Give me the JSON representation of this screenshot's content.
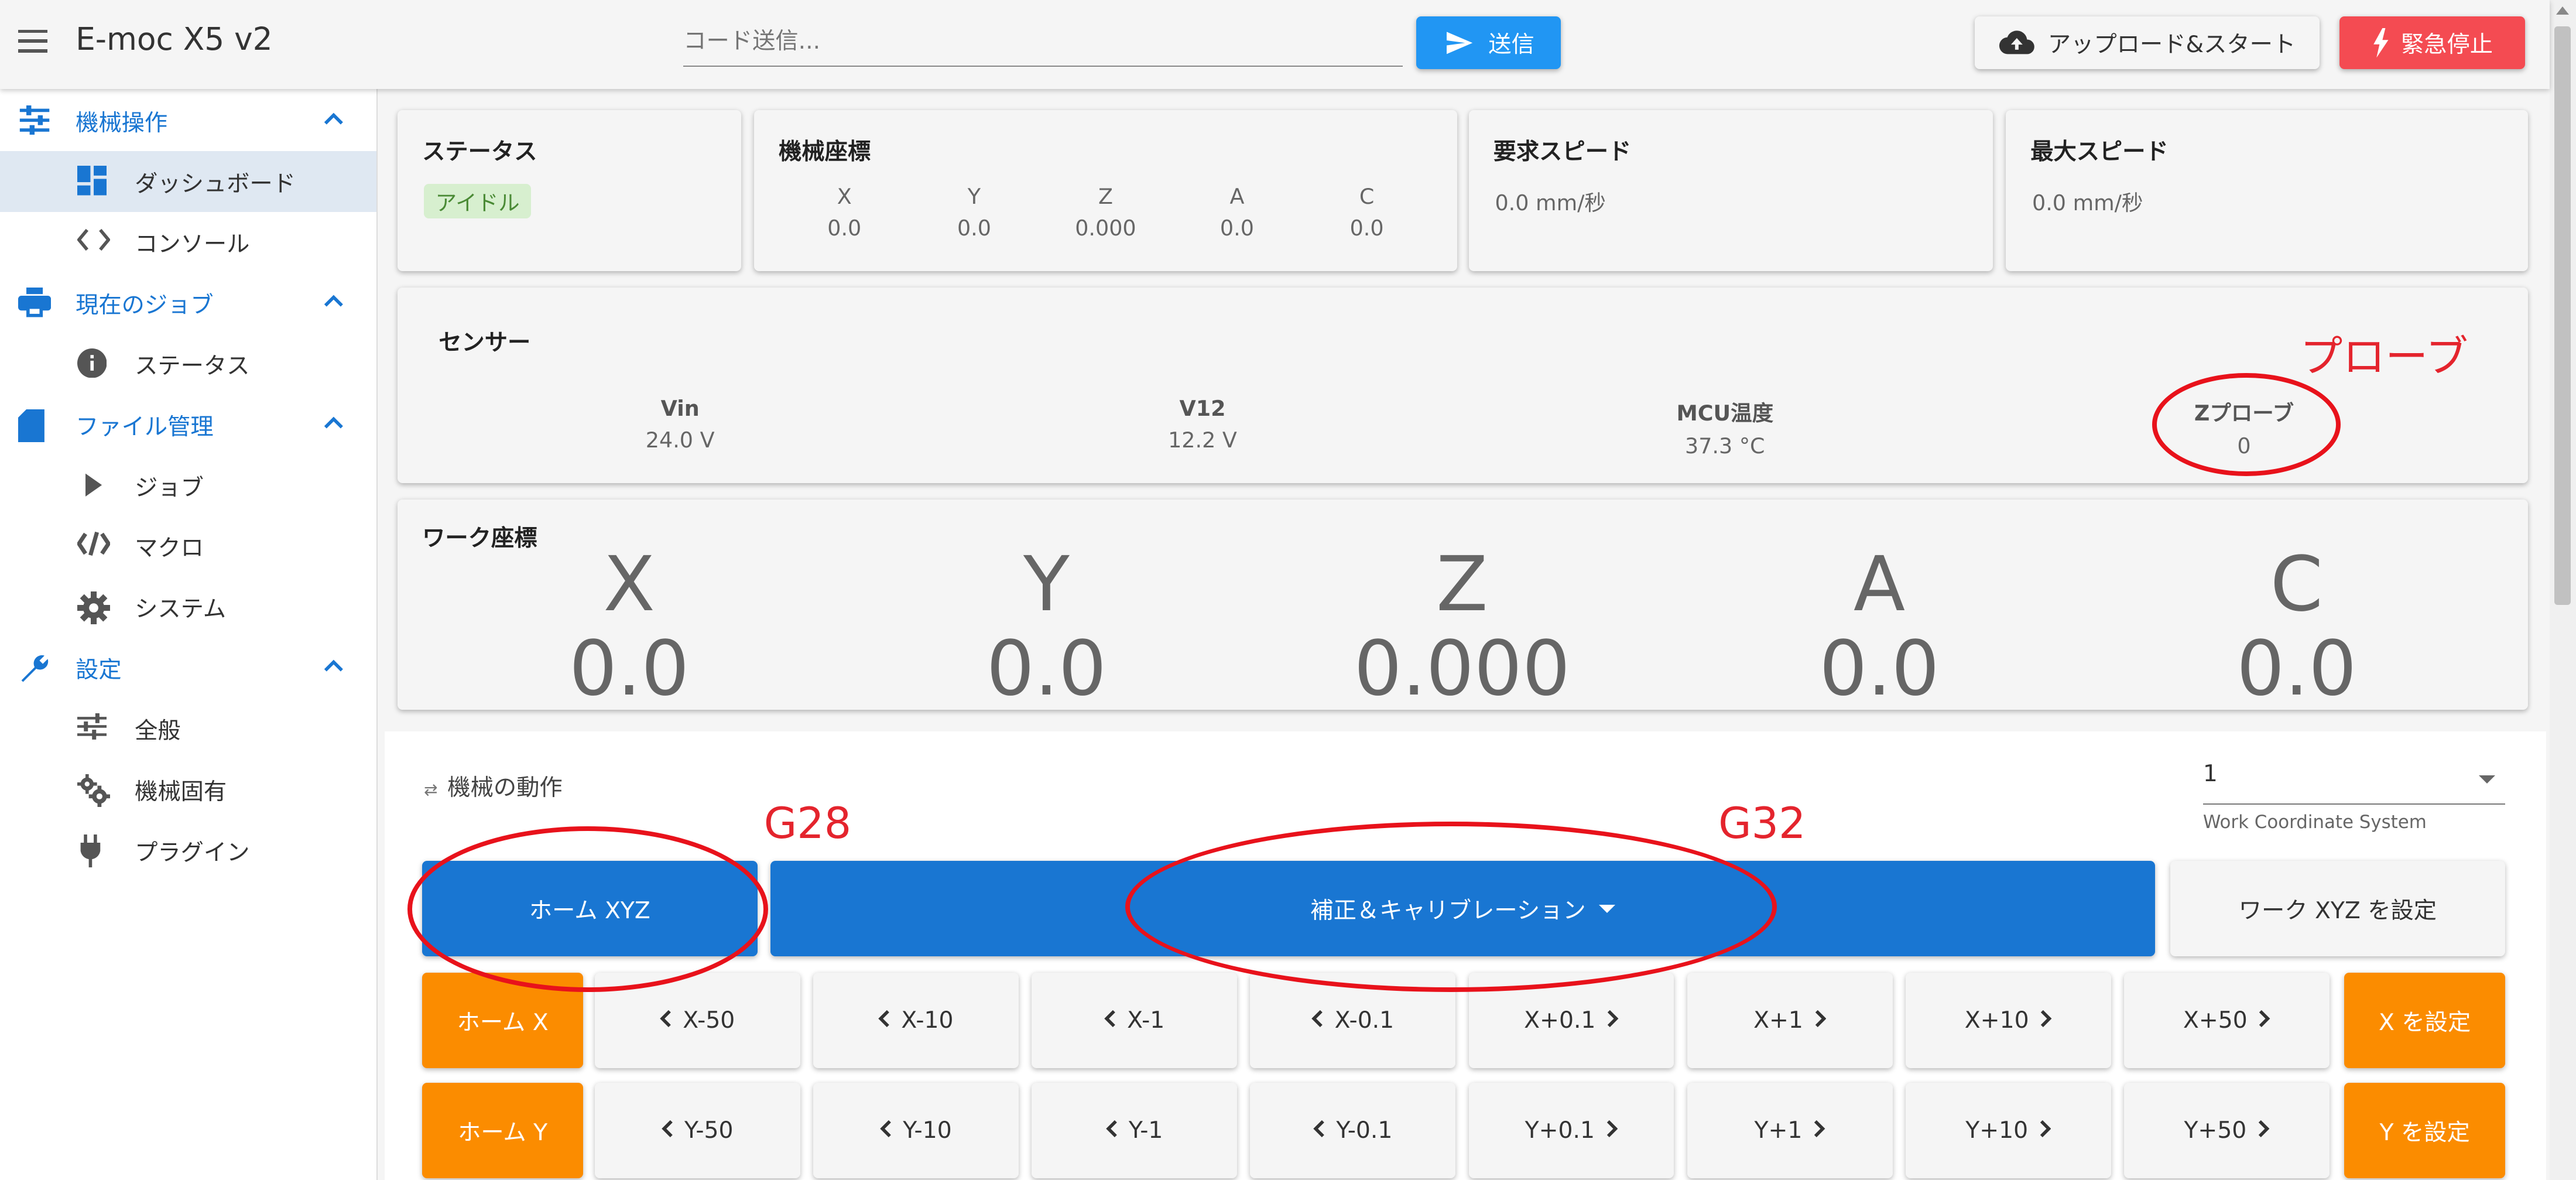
{
  "app": {
    "title": "E-moc X5 v2",
    "code_placeholder": "コード送信...",
    "send_label": "送信",
    "upload_label": "アップロード&スタート",
    "estop_label": "緊急停止",
    "colors": {
      "primary": "#1976d2",
      "send": "#2196f3",
      "estop": "#f44b52",
      "orange": "#fb8c00",
      "annotation": "#e4242d"
    }
  },
  "sidebar": {
    "groups": [
      {
        "label": "機械操作",
        "icon": "tune-icon",
        "items": [
          {
            "label": "ダッシュボード",
            "icon": "dashboard-icon",
            "active": true
          },
          {
            "label": "コンソール",
            "icon": "code-icon"
          }
        ]
      },
      {
        "label": "現在のジョブ",
        "icon": "printer-icon",
        "items": [
          {
            "label": "ステータス",
            "icon": "info-icon"
          }
        ]
      },
      {
        "label": "ファイル管理",
        "icon": "sd-card-icon",
        "items": [
          {
            "label": "ジョブ",
            "icon": "play-icon"
          },
          {
            "label": "マクロ",
            "icon": "macro-icon"
          },
          {
            "label": "システム",
            "icon": "gear-icon"
          }
        ]
      },
      {
        "label": "設定",
        "icon": "wrench-icon",
        "items": [
          {
            "label": "全般",
            "icon": "sliders-icon"
          },
          {
            "label": "機械固有",
            "icon": "gears-icon"
          },
          {
            "label": "プラグイン",
            "icon": "plug-icon"
          }
        ]
      }
    ]
  },
  "status": {
    "title": "ステータス",
    "state": "アイドル"
  },
  "machine_coords": {
    "title": "機械座標",
    "axes": [
      {
        "name": "X",
        "value": "0.0"
      },
      {
        "name": "Y",
        "value": "0.0"
      },
      {
        "name": "Z",
        "value": "0.000"
      },
      {
        "name": "A",
        "value": "0.0"
      },
      {
        "name": "C",
        "value": "0.0"
      }
    ]
  },
  "requested_speed": {
    "title": "要求スピード",
    "value": "0.0 mm/秒"
  },
  "max_speed": {
    "title": "最大スピード",
    "value": "0.0 mm/秒"
  },
  "sensors": {
    "title": "センサー",
    "items": [
      {
        "label": "Vin",
        "value": "24.0 V"
      },
      {
        "label": "V12",
        "value": "12.2 V"
      },
      {
        "label": "MCU温度",
        "value": "37.3 °C"
      },
      {
        "label": "Zプローブ",
        "value": "0"
      }
    ]
  },
  "work_coords": {
    "title": "ワーク座標",
    "axes": [
      {
        "name": "X",
        "value": "0.0"
      },
      {
        "name": "Y",
        "value": "0.0"
      },
      {
        "name": "Z",
        "value": "0.000"
      },
      {
        "name": "A",
        "value": "0.0"
      },
      {
        "name": "C",
        "value": "0.0"
      }
    ]
  },
  "annotations": {
    "probe": "プローブ",
    "g28": "G28",
    "g32": "G32"
  },
  "movement": {
    "title": "機械の動作",
    "wcs_value": "1",
    "wcs_hint": "Work Coordinate System",
    "home_all": "ホーム XYZ",
    "calibrate": "補正＆キャリブレーション",
    "set_work": "ワーク XYZ を設定",
    "rows": [
      {
        "home": "ホーム X",
        "set": "X を設定",
        "minus": [
          "X-50",
          "X-10",
          "X-1",
          "X-0.1"
        ],
        "plus": [
          "X+0.1",
          "X+1",
          "X+10",
          "X+50"
        ]
      },
      {
        "home": "ホーム Y",
        "set": "Y を設定",
        "minus": [
          "Y-50",
          "Y-10",
          "Y-1",
          "Y-0.1"
        ],
        "plus": [
          "Y+0.1",
          "Y+1",
          "Y+10",
          "Y+50"
        ]
      }
    ]
  }
}
